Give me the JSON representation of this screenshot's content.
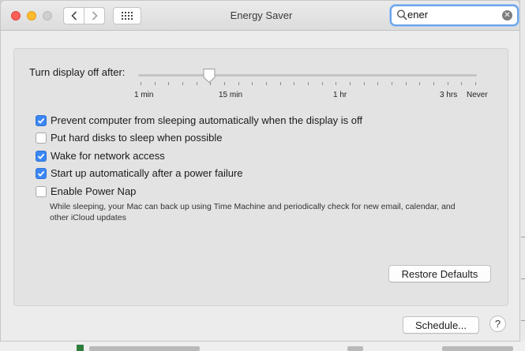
{
  "window": {
    "title": "Energy Saver",
    "search": {
      "value": "ener"
    }
  },
  "toolbar": {
    "back_icon": "chevron-left-icon",
    "forward_icon": "chevron-right-icon",
    "grid_icon": "show-all-grid-icon"
  },
  "display_sleep": {
    "label": "Turn display off after:",
    "ticks": [
      "1 min",
      "15 min",
      "1 hr",
      "3 hrs",
      "Never"
    ],
    "current_value": "15 min"
  },
  "options": [
    {
      "label": "Prevent computer from sleeping automatically when the display is off",
      "checked": true
    },
    {
      "label": "Put hard disks to sleep when possible",
      "checked": false
    },
    {
      "label": "Wake for network access",
      "checked": true
    },
    {
      "label": "Start up automatically after a power failure",
      "checked": true
    },
    {
      "label": "Enable Power Nap",
      "checked": false
    }
  ],
  "power_nap_note": "While sleeping, your Mac can back up using Time Machine and periodically check for new email, calendar, and other iCloud updates",
  "buttons": {
    "restore_defaults": "Restore Defaults",
    "schedule": "Schedule...",
    "help": "?"
  },
  "colors": {
    "accent": "#3a87f4",
    "close": "#fe5f57",
    "minimize": "#febb2e",
    "search_focus": "#6aa4ea"
  }
}
